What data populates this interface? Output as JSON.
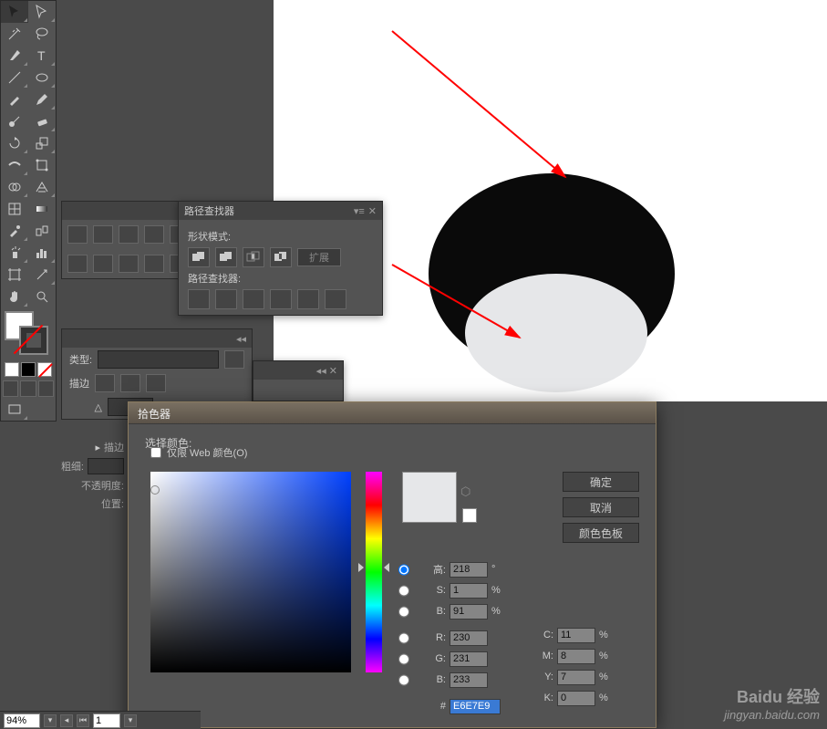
{
  "pathfinder": {
    "title": "路径查找器",
    "shape_modes_label": "形状模式:",
    "pathfinders_label": "路径查找器:",
    "expand_label": "扩展"
  },
  "appearance": {
    "type_label": "类型:",
    "stroke_label": "描边"
  },
  "stroke_panel": {
    "title": "描边",
    "weight_label": "粗细:",
    "opacity_label": "不透明度:",
    "position_label": "位置:"
  },
  "picker": {
    "title": "拾色器",
    "select_label": "选择颜色:",
    "ok": "确定",
    "cancel": "取消",
    "swatches": "颜色色板",
    "h_label": "高:",
    "h_val": "218",
    "h_unit": "°",
    "s_label": "S:",
    "s_val": "1",
    "s_unit": "%",
    "b_label": "B:",
    "b_val": "91",
    "b_unit": "%",
    "r_label": "R:",
    "r_val": "230",
    "g_label": "G:",
    "g_val": "231",
    "bb_label": "B:",
    "bb_val": "233",
    "c_label": "C:",
    "c_val": "11",
    "c_unit": "%",
    "m_label": "M:",
    "m_val": "8",
    "m_unit": "%",
    "y_label": "Y:",
    "y_val": "7",
    "y_unit": "%",
    "k_label": "K:",
    "k_val": "0",
    "k_unit": "%",
    "hex_label": "#",
    "hex_val": "E6E7E9",
    "web_only": "仅限 Web 颜色(O)"
  },
  "status": {
    "zoom": "94%",
    "page": "1"
  },
  "watermark": {
    "brand": "Baidu 经验",
    "url": "jingyan.baidu.com"
  }
}
